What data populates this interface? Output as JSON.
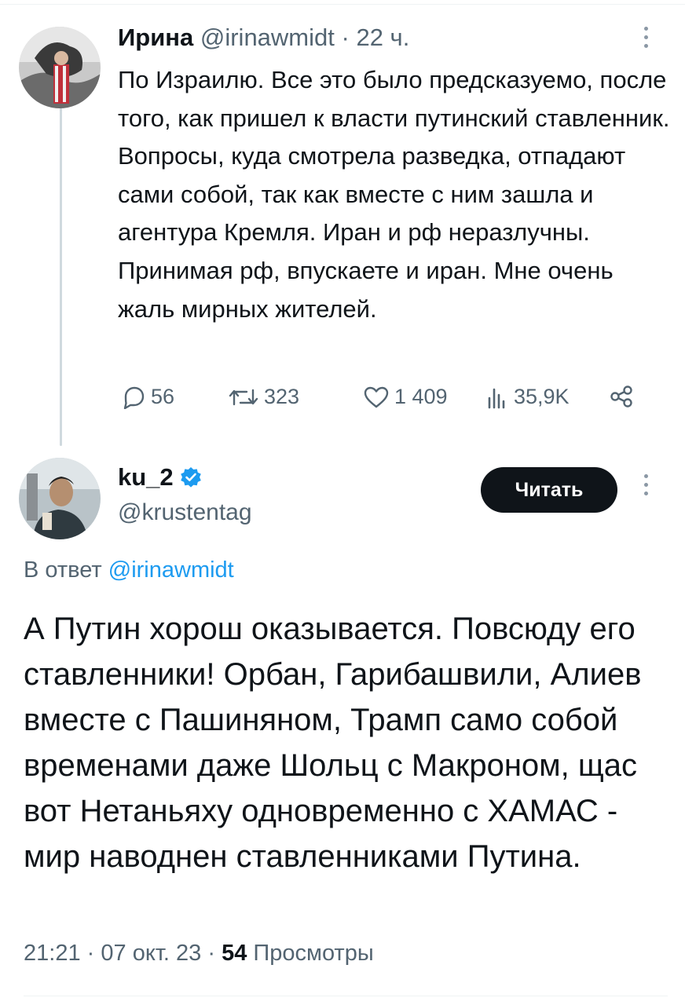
{
  "tweet1": {
    "author_name": "Ирина",
    "handle": "@irinawmidt",
    "time": "22 ч.",
    "text": "По Израилю. Все это было предсказуемо, после того, как пришел к власти путинский ставленник. Вопросы, куда смотрела разведка, отпадают сами собой, так как вместе с ним зашла и агентура Кремля. Иран и рф неразлучны. Принимая рф, впускаете и иран. Мне очень жаль мирных жителей.",
    "stats": {
      "replies": "56",
      "retweets": "323",
      "likes": "1 409",
      "views": "35,9K"
    }
  },
  "tweet2": {
    "author_name": "ku_2",
    "handle": "@krustentag",
    "follow_label": "Читать",
    "reply_prefix": "В ответ",
    "reply_mention": "@irinawmidt",
    "text": "А Путин хорош оказывается. Повсюду его ставленники! Орбан, Гарибашвили, Алиев вместе с Пашиняном, Трамп само собой временами даже Шольц с Макроном, щас вот Нетаньяху одновременно с ХАМАС - мир наводнен ставленниками Путина.",
    "time": "21:21",
    "date": "07 окт. 23",
    "views_count": "54",
    "views_label": "Просмотры"
  },
  "colors": {
    "text": "#0f1419",
    "secondary": "#536471",
    "link": "#1d9bf0",
    "verified": "#1d9bf0",
    "button_bg": "#0f1419"
  },
  "icons": {
    "reply": "reply-icon",
    "retweet": "retweet-icon",
    "like": "heart-icon",
    "views": "analytics-icon",
    "share": "share-icon",
    "verified": "verified-badge-icon",
    "more": "more-vertical-icon"
  }
}
